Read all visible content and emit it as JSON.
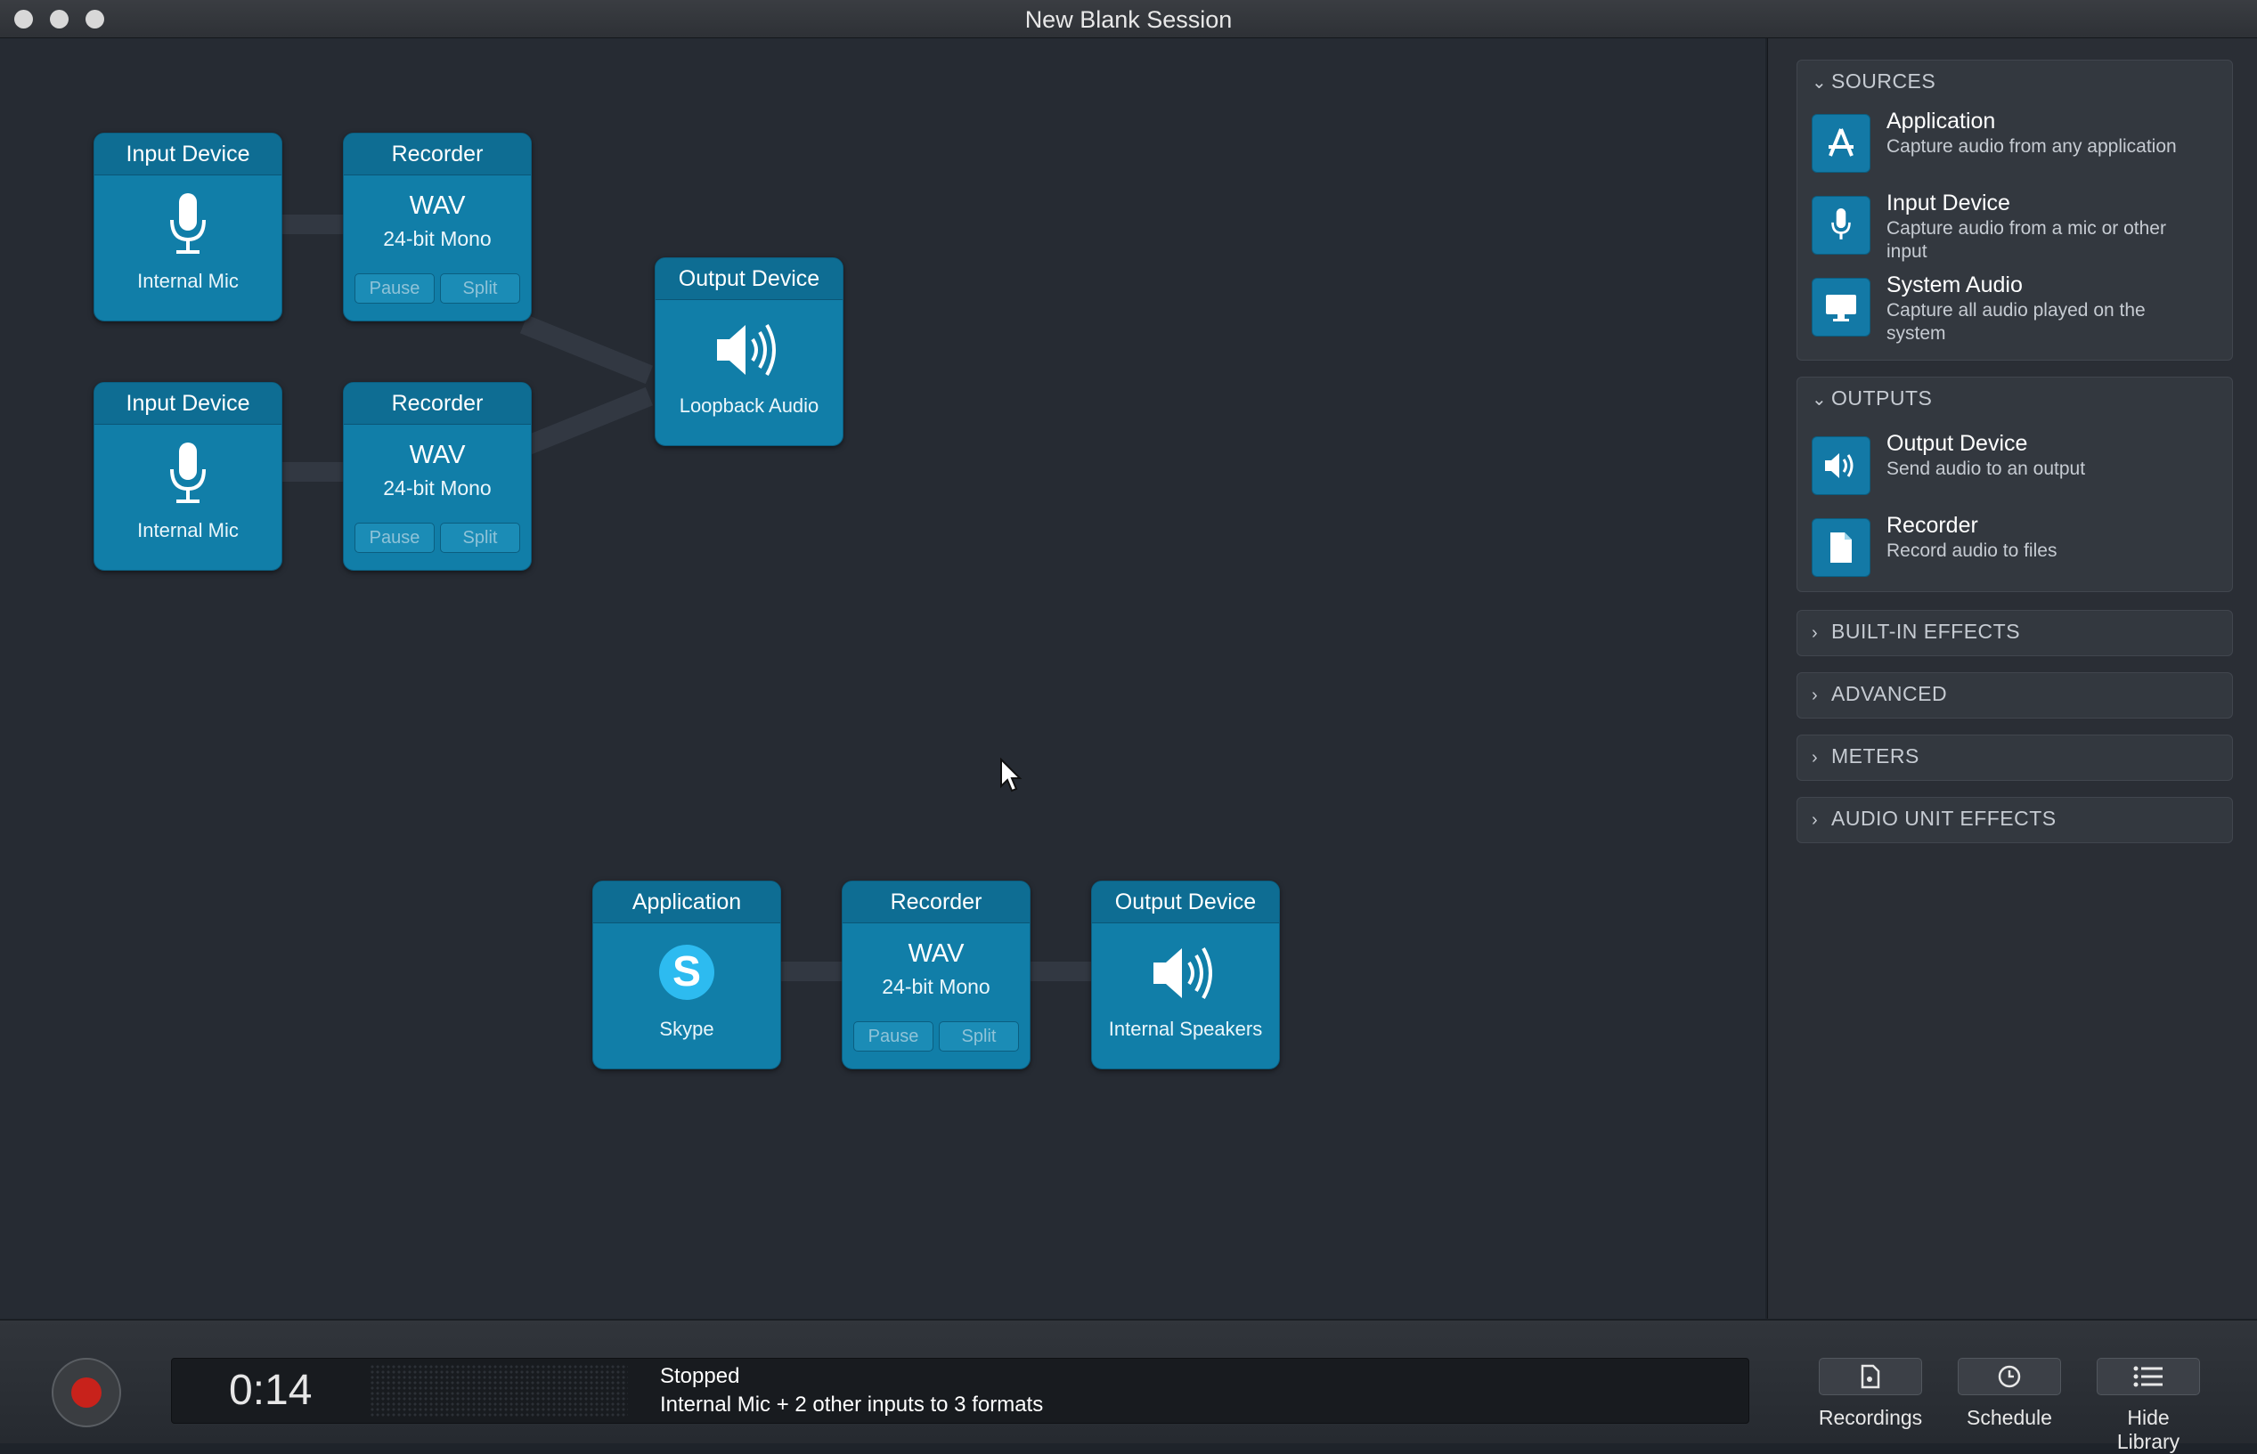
{
  "window": {
    "title": "New Blank Session"
  },
  "canvas": {
    "nodes": [
      {
        "id": "input1",
        "kind": "input-device",
        "header": "Input Device",
        "label": "Internal Mic"
      },
      {
        "id": "rec1",
        "kind": "recorder",
        "header": "Recorder",
        "format": "WAV",
        "detail": "24-bit Mono",
        "pause": "Pause",
        "split": "Split"
      },
      {
        "id": "out1",
        "kind": "output-device",
        "header": "Output Device",
        "label": "Loopback Audio"
      },
      {
        "id": "input2",
        "kind": "input-device",
        "header": "Input Device",
        "label": "Internal Mic"
      },
      {
        "id": "rec2",
        "kind": "recorder",
        "header": "Recorder",
        "format": "WAV",
        "detail": "24-bit Mono",
        "pause": "Pause",
        "split": "Split"
      },
      {
        "id": "app1",
        "kind": "application",
        "header": "Application",
        "label": "Skype"
      },
      {
        "id": "rec3",
        "kind": "recorder",
        "header": "Recorder",
        "format": "WAV",
        "detail": "24-bit Mono",
        "pause": "Pause",
        "split": "Split"
      },
      {
        "id": "out2",
        "kind": "output-device",
        "header": "Output Device",
        "label": "Internal Speakers"
      }
    ]
  },
  "library": {
    "sources": {
      "title": "SOURCES",
      "items": [
        {
          "title": "Application",
          "desc": "Capture audio from any application",
          "icon": "app-store-icon"
        },
        {
          "title": "Input Device",
          "desc": "Capture audio from a mic or other input",
          "icon": "microphone-icon"
        },
        {
          "title": "System Audio",
          "desc": "Capture all audio played on the system",
          "icon": "monitor-icon"
        }
      ]
    },
    "outputs": {
      "title": "OUTPUTS",
      "items": [
        {
          "title": "Output Device",
          "desc": "Send audio to an output",
          "icon": "speaker-icon"
        },
        {
          "title": "Recorder",
          "desc": "Record audio to files",
          "icon": "document-icon"
        }
      ]
    },
    "collapsed": [
      "BUILT-IN EFFECTS",
      "ADVANCED",
      "METERS",
      "AUDIO UNIT EFFECTS"
    ]
  },
  "transport": {
    "time": "0:14",
    "status": "Stopped",
    "summary": "Internal Mic + 2 other inputs to 3 formats"
  },
  "toolbar": {
    "recordings": "Recordings",
    "schedule": "Schedule",
    "hide_library": "Hide Library"
  },
  "colors": {
    "node": "#117ea8",
    "canvas": "#262b33",
    "record": "#c8221b"
  }
}
